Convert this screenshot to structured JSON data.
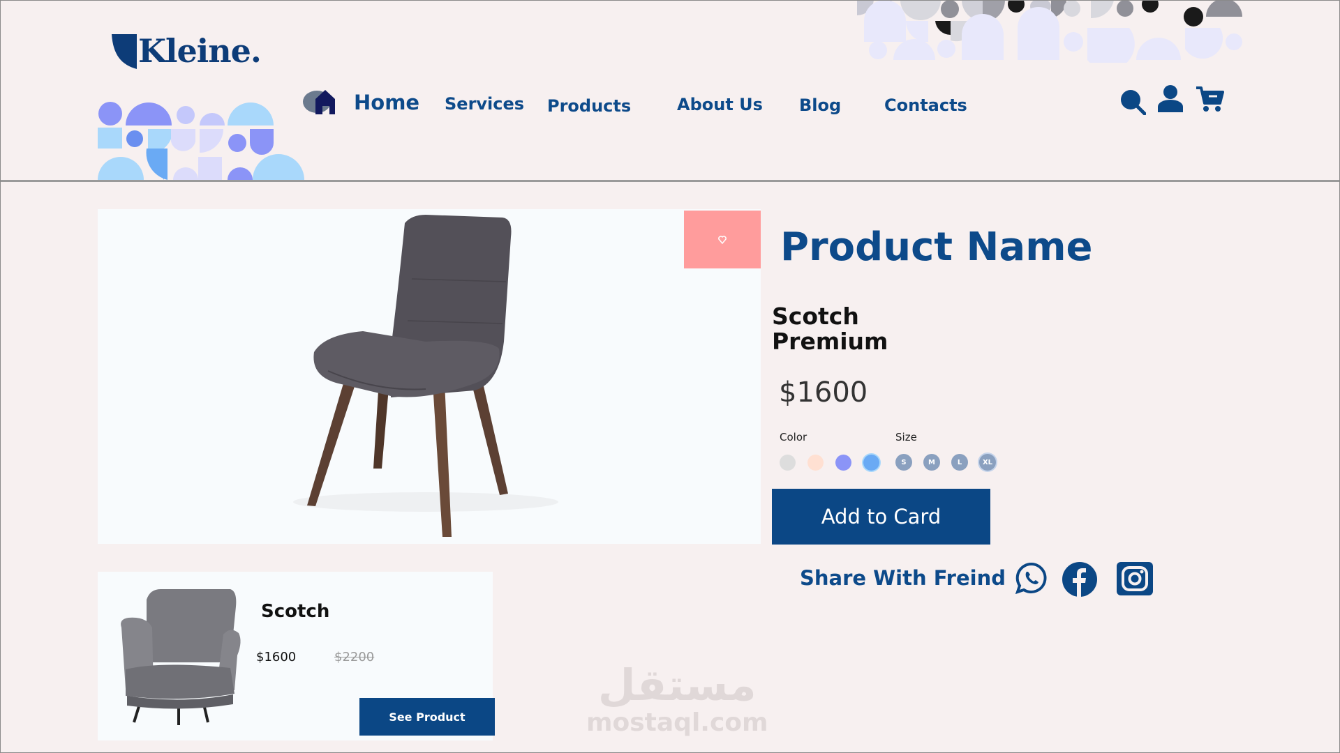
{
  "brand": {
    "name": "Kleine."
  },
  "nav": {
    "items": [
      {
        "label": "Home"
      },
      {
        "label": "Services"
      },
      {
        "label": "Products"
      },
      {
        "label": "About Us"
      },
      {
        "label": "Blog"
      },
      {
        "label": "Contacts"
      }
    ]
  },
  "header_icons": [
    "search-icon",
    "user-icon",
    "cart-icon"
  ],
  "product": {
    "name": "Product Name",
    "subtitle": "Scotch Premium",
    "price": "$1600",
    "color_label": "Color",
    "colors": [
      "#dddddd",
      "#ffe0d2",
      "#8b94f7",
      "#6aaaf4"
    ],
    "size_label": "Size",
    "sizes": [
      "S",
      "M",
      "L",
      "XL"
    ],
    "add_button": "Add to Card",
    "share_label": "Share With Freind",
    "social": [
      "whatsapp-icon",
      "facebook-icon",
      "instagram-icon"
    ]
  },
  "related": {
    "title": "Scotch",
    "price": "$1600",
    "old_price": "$2200",
    "button": "See Product"
  },
  "watermark": {
    "arabic": "مستقل",
    "latin": "mostaql.com"
  },
  "colors": {
    "primary": "#0b4785",
    "accent_fav": "#ff9c9c",
    "background": "#f7f0f0"
  }
}
